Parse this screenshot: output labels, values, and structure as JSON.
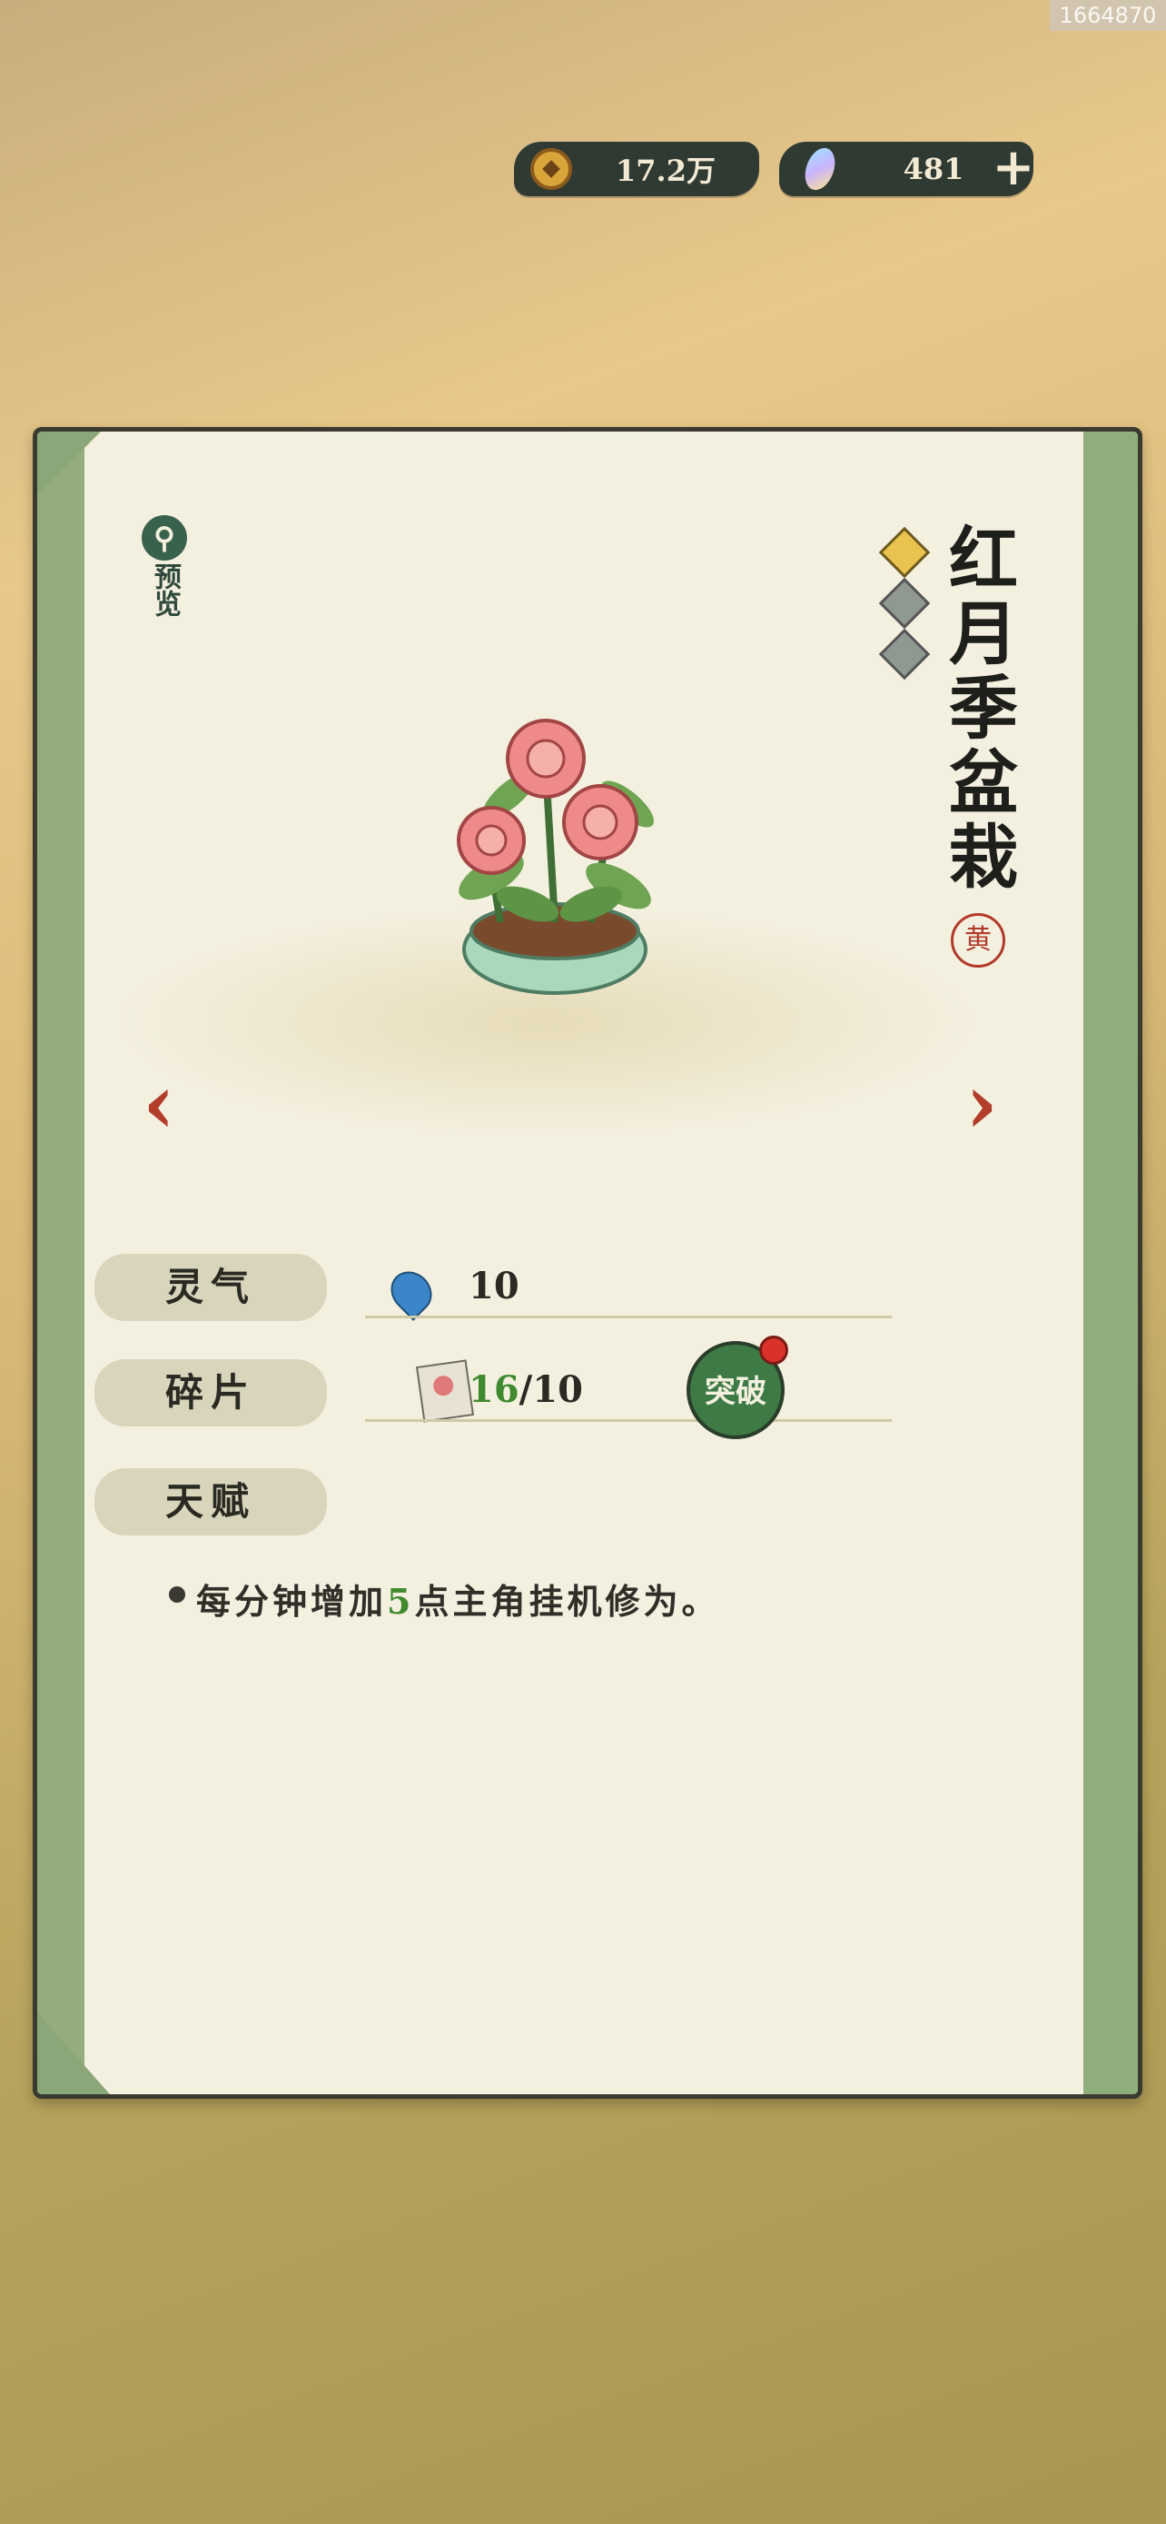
{
  "watermark": "1664870",
  "currency": {
    "coins": "17.2万",
    "gems": "481",
    "add_label": "+"
  },
  "item": {
    "preview_label": "预览",
    "name": "红月季盆栽",
    "seal_char": "黄",
    "stars_filled": 1,
    "stars_total": 3
  },
  "stats": {
    "spirit_label": "灵气",
    "spirit_value": "10",
    "fragments_label": "碎片",
    "fragments_current": "16",
    "fragments_sep": "/",
    "fragments_required": "10",
    "breakthrough_label": "突破",
    "talent_label": "天赋",
    "talent_prefix": "每分钟增加",
    "talent_value": "5",
    "talent_suffix": "点主角挂机修为。"
  },
  "nav": {
    "prev": "‹",
    "next": "›"
  },
  "colors": {
    "accent_green": "#3f8a2e",
    "arrow_red": "#b23d2b",
    "star_gold": "#e8c350"
  }
}
